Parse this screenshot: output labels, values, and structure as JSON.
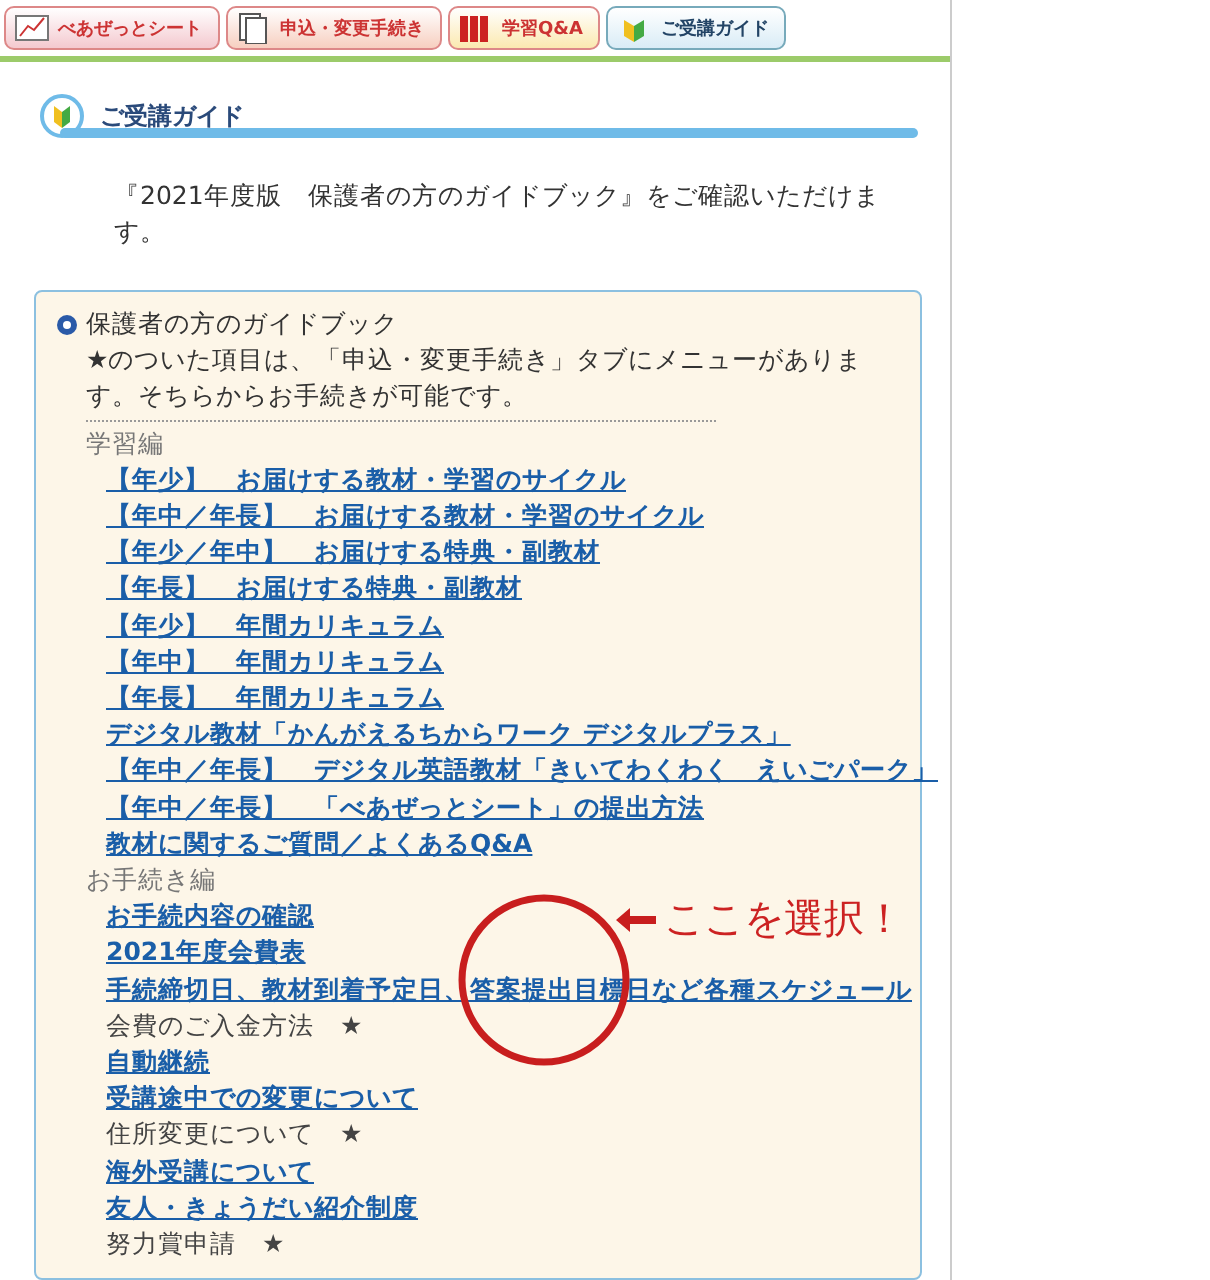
{
  "tabs": [
    {
      "label": "べあぜっとシート",
      "color": "#f4c9cf",
      "selected": false
    },
    {
      "label": "申込・変更手続き",
      "color": "#f7cfc0",
      "selected": false
    },
    {
      "label": "学習Q&A",
      "color": "#fbe9b0",
      "selected": false
    },
    {
      "label": "ご受講ガイド",
      "color": "#d9ecf6",
      "selected": true
    }
  ],
  "page_title": "ご受講ガイド",
  "intro": "『2021年度版　保護者の方のガイドブック』をご確認いただけます。",
  "guide": {
    "title": "保護者の方のガイドブック",
    "note": "★のついた項目は、「申込・変更手続き」タブにメニューがあります。そちらからお手続きが可能です。",
    "sections": [
      {
        "heading": "学習編",
        "items": [
          {
            "kind": "link",
            "text": "【年少】　お届けする教材・学習のサイクル"
          },
          {
            "kind": "link",
            "text": "【年中／年長】　お届けする教材・学習のサイクル"
          },
          {
            "kind": "link",
            "text": "【年少／年中】　お届けする特典・副教材"
          },
          {
            "kind": "link",
            "text": "【年長】　お届けする特典・副教材"
          },
          {
            "kind": "link",
            "text": "【年少】　年間カリキュラム"
          },
          {
            "kind": "link",
            "text": "【年中】　年間カリキュラム"
          },
          {
            "kind": "link",
            "text": "【年長】　年間カリキュラム"
          },
          {
            "kind": "link",
            "text": "デジタル教材「かんがえるちからワーク デジタルプラス」"
          },
          {
            "kind": "link",
            "text": "【年中／年長】　デジタル英語教材「きいてわくわく　えいごパーク」"
          },
          {
            "kind": "link",
            "text": "【年中／年長】　「べあぜっとシート」の提出方法"
          },
          {
            "kind": "link",
            "text": "教材に関するご質問／よくあるQ&A"
          }
        ]
      },
      {
        "heading": "お手続き編",
        "items": [
          {
            "kind": "link",
            "text": "お手続内容の確認"
          },
          {
            "kind": "link",
            "text": "2021年度会費表"
          },
          {
            "kind": "link",
            "text": "手続締切日、教材到着予定日、答案提出目標日など各種スケジュール"
          },
          {
            "kind": "plain",
            "text": "会費のご入金方法　★"
          },
          {
            "kind": "link",
            "text": "自動継続"
          },
          {
            "kind": "link",
            "text": "受講途中での変更について"
          },
          {
            "kind": "plain",
            "text": "住所変更について　★"
          },
          {
            "kind": "link",
            "text": "海外受講について"
          },
          {
            "kind": "link",
            "text": "友人・きょうだい紹介制度"
          },
          {
            "kind": "plain",
            "text": "努力賞申請　★"
          }
        ]
      }
    ]
  },
  "annotation": {
    "text": "ここを選択！"
  }
}
